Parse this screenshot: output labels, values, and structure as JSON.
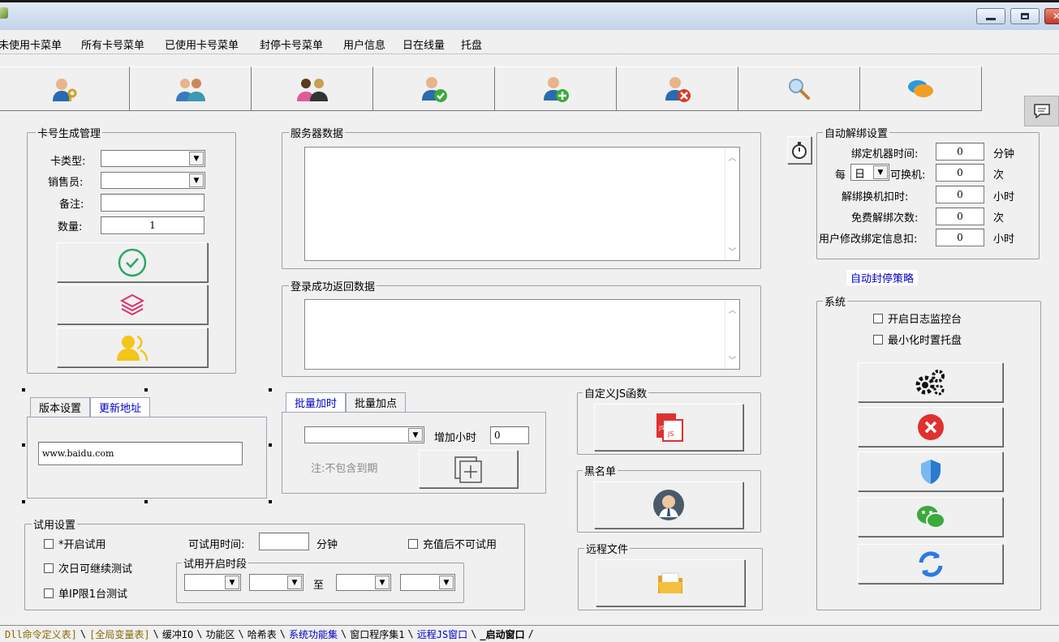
{
  "menu": [
    "未使用卡菜单",
    "所有卡号菜单",
    "已使用卡号菜单",
    "封停卡号菜单",
    "用户信息",
    "日在线量",
    "托盘"
  ],
  "toolbar_icons": [
    "user-key-icon",
    "users-icon",
    "group-icon",
    "user-check-icon",
    "user-add-icon",
    "user-remove-icon",
    "search-icon",
    "chat-icon"
  ],
  "cardgen": {
    "title": "卡号生成管理",
    "type_label": "卡类型:",
    "seller_label": "销售员:",
    "remark_label": "备注:",
    "qty_label": "数量:",
    "qty_value": "1"
  },
  "server": {
    "title": "服务器数据"
  },
  "login": {
    "title": "登录成功返回数据"
  },
  "autounbind": {
    "title": "自动解绑设置",
    "bind_time": "绑定机器时间:",
    "bind_time_val": "0",
    "bind_time_unit": "分钟",
    "every": "每",
    "every_sel": "日",
    "switch": "可换机:",
    "switch_val": "0",
    "switch_unit": "次",
    "deduct": "解绑换机扣时:",
    "deduct_val": "0",
    "deduct_unit": "小时",
    "free": "免费解绑次数:",
    "free_val": "0",
    "free_unit": "次",
    "modify": "用户修改绑定信息扣:",
    "modify_val": "0",
    "modify_unit": "小时"
  },
  "autoban": {
    "label": "自动封停策略"
  },
  "system": {
    "title": "系统",
    "log": "开启日志监控台",
    "tray": "最小化时置托盘"
  },
  "version_tabs": {
    "tab1": "版本设置",
    "tab2": "更新地址",
    "url": "www.baidu.com"
  },
  "batch_tabs": {
    "tab1": "批量加时",
    "tab2": "批量加点",
    "add_hours": "增加小时",
    "add_hours_val": "0",
    "note": "注:不包含到期"
  },
  "customjs": {
    "title": "自定义JS函数"
  },
  "blacklist": {
    "title": "黑名单"
  },
  "remote": {
    "title": "远程文件"
  },
  "trial": {
    "title": "试用设置",
    "enable": "*开启试用",
    "time_label": "可试用时间:",
    "time_unit": "分钟",
    "no_trial": "充值后不可试用",
    "next_day": "次日可继续测试",
    "single_ip": "单IP限1台测试",
    "period": "试用开启时段",
    "to": "至"
  },
  "bottom_tabs": [
    "Dll命令定义表]",
    "[全局变量表]",
    "缓冲IO",
    "功能区",
    "哈希表",
    "系统功能集",
    "窗口程序集1",
    "远程JS窗口",
    "_启动窗口"
  ]
}
